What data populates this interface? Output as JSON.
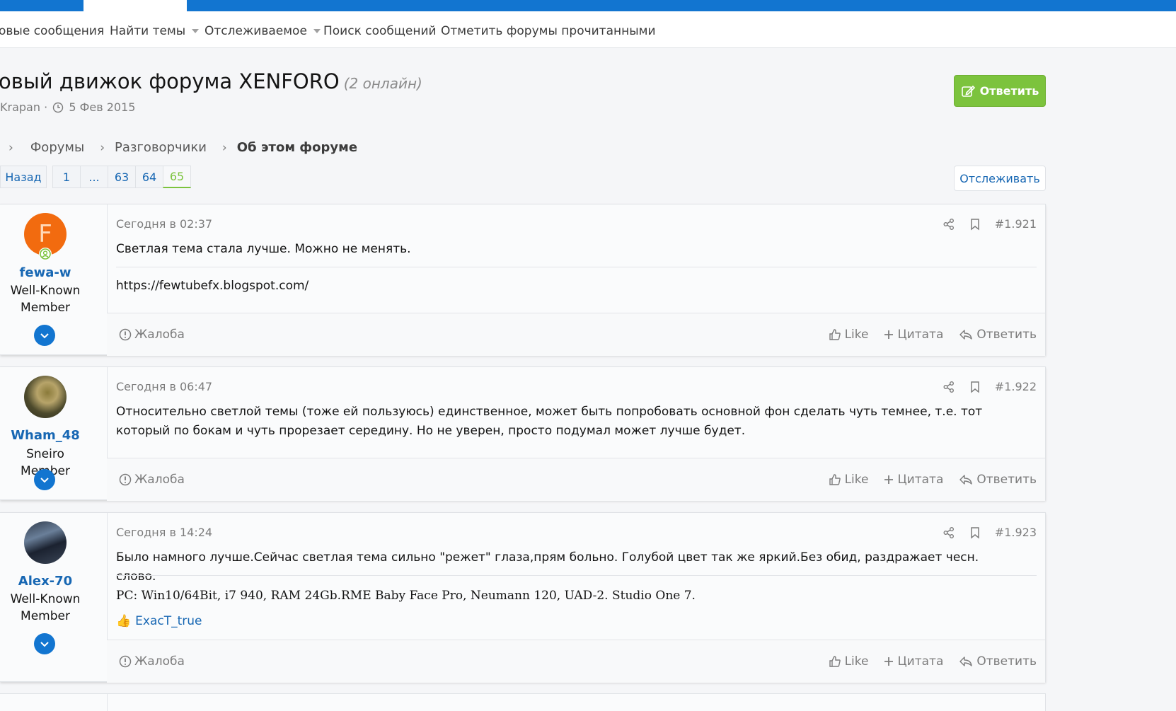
{
  "subnav": {
    "items": [
      {
        "label": "овые сообщения",
        "dropdown": false
      },
      {
        "label": "Найти темы",
        "dropdown": true
      },
      {
        "label": "Отслеживаемое",
        "dropdown": true
      },
      {
        "label": "Поиск сообщений",
        "dropdown": false
      },
      {
        "label": "Отметить форумы прочитанными",
        "dropdown": false
      }
    ]
  },
  "thread": {
    "title": "овый движок форума XENFORO",
    "online": "(2 онлайн)",
    "author": "Krapan",
    "date": "5 Фев 2015",
    "reply_label": "Ответить",
    "watch_label": "Отслеживать"
  },
  "breadcrumb": {
    "items": [
      "Форумы",
      "Разговорчики",
      "Об этом форуме"
    ]
  },
  "pager": {
    "back": "Назад",
    "pages": [
      "1",
      "...",
      "63",
      "64",
      "65"
    ],
    "current": "65"
  },
  "colors": {
    "accent": "#1275d0",
    "link": "#1767b3",
    "reply_button": "#7cc33d"
  },
  "posts": [
    {
      "username": "fewa-w",
      "user_title": "Well-Known Member",
      "avatar_letter": "F",
      "avatar_color": "#f26b0f",
      "time": "Сегодня в 02:37",
      "number": "#1.921",
      "text": "Светлая тема стала лучше. Можно не менять.",
      "link": "https://fewtubefx.blogspot.com/",
      "report": "Жалоба",
      "like": "Like",
      "quote": "Цитата",
      "reply": "Ответить"
    },
    {
      "username": "Wham_48",
      "user_title": "Sneiro Member",
      "time": "Сегодня в 06:47",
      "number": "#1.922",
      "text": "Относительно светлой темы (тоже ей пользуюсь) единственное, может быть попробовать основной фон сделать чуть темнее, т.е. тот который по бокам и чуть прорезает середину. Но не уверен, просто подумал может лучше будет.",
      "report": "Жалоба",
      "like": "Like",
      "quote": "Цитата",
      "reply": "Ответить"
    },
    {
      "username": "Alex-70",
      "user_title": "Well-Known Member",
      "time": "Сегодня в 14:24",
      "number": "#1.923",
      "text": "Было намного лучше.Сейчас светлая тема сильно \"режет\" глаза,прям больно. Голубой цвет так же яркий.Без обид, раздражает чесн. слово.",
      "signature": "PC: Win10/64Bit, i7 940, RAM 24Gb.RME Baby Face Pro, Neumann 120, UAD-2. Studio One 7.",
      "liked_by": "ExacT_true",
      "report": "Жалоба",
      "like": "Like",
      "quote": "Цитата",
      "reply": "Ответить"
    }
  ]
}
